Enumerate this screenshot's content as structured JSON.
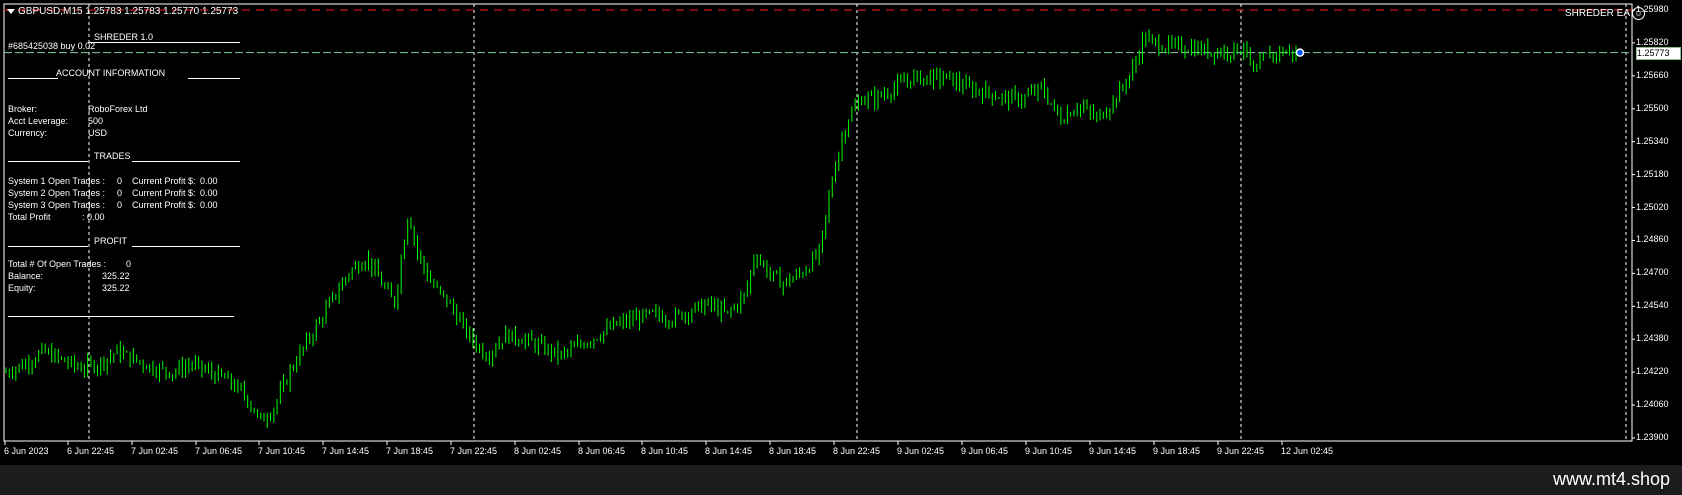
{
  "header": {
    "symbol_info": "GBPUSD,M15  1.25783 1.25783 1.25770 1.25773"
  },
  "ea_name": "SHREDER EA",
  "panel": {
    "title": "SHREDER 1.0",
    "account_heading": "ACCOUNT INFORMATION",
    "broker_label": "Broker:",
    "broker_value": "RoboForex Ltd",
    "leverage_label": "Acct Leverage:",
    "leverage_value": "500",
    "currency_label": "Currency:",
    "currency_value": "USD",
    "trades_heading": "TRADES",
    "systems": [
      {
        "label": "System 1 Open Trades :",
        "open": "0",
        "profit_label": "Current Profit $:",
        "profit": "0.00"
      },
      {
        "label": "System 2 Open Trades :",
        "open": "0",
        "profit_label": "Current Profit $:",
        "profit": "0.00"
      },
      {
        "label": "System 3 Open Trades :",
        "open": "0",
        "profit_label": "Current Profit $:",
        "profit": "0.00"
      }
    ],
    "total_profit_label": "Total Profit",
    "total_profit_value": ": 0.00",
    "profit_heading": "PROFIT",
    "open_trades_label": "Total # Of Open Trades :",
    "open_trades_value": "0",
    "balance_label": "Balance:",
    "balance_value": "325.22",
    "equity_label": "Equity:",
    "equity_value": "325.22"
  },
  "order_label": "#685425038 buy 0.02",
  "price_axis": {
    "labels": [
      "1.25980",
      "1.25820",
      "1.25773",
      "1.25660",
      "1.25500",
      "1.25340",
      "1.25180",
      "1.25020",
      "1.24860",
      "1.24700",
      "1.24540",
      "1.24380",
      "1.24220",
      "1.24060",
      "1.23900"
    ],
    "current": "1.25773"
  },
  "time_axis": {
    "labels": [
      "6 Jun 2023",
      "6 Jun 22:45",
      "7 Jun 02:45",
      "7 Jun 06:45",
      "7 Jun 10:45",
      "7 Jun 14:45",
      "7 Jun 18:45",
      "7 Jun 22:45",
      "8 Jun 02:45",
      "8 Jun 06:45",
      "8 Jun 10:45",
      "8 Jun 14:45",
      "8 Jun 18:45",
      "8 Jun 22:45",
      "9 Jun 02:45",
      "9 Jun 06:45",
      "9 Jun 10:45",
      "9 Jun 14:45",
      "9 Jun 18:45",
      "9 Jun 22:45",
      "12 Jun 02:45"
    ]
  },
  "chart_data": {
    "type": "candlestick",
    "symbol": "GBPUSD",
    "timeframe": "M15",
    "ylim": [
      1.239,
      1.2598
    ],
    "order_price": 1.25773,
    "stop_level": 1.2598,
    "close_path": [
      [
        0,
        1.2422
      ],
      [
        4,
        1.2426
      ],
      [
        8,
        1.2432
      ],
      [
        12,
        1.2428
      ],
      [
        16,
        1.2424
      ],
      [
        20,
        1.2426
      ],
      [
        24,
        1.2432
      ],
      [
        28,
        1.2428
      ],
      [
        32,
        1.2424
      ],
      [
        36,
        1.2422
      ],
      [
        40,
        1.2426
      ],
      [
        44,
        1.2422
      ],
      [
        48,
        1.2418
      ],
      [
        52,
        1.241
      ],
      [
        55,
        1.2398
      ],
      [
        58,
        1.2405
      ],
      [
        62,
        1.2425
      ],
      [
        66,
        1.244
      ],
      [
        70,
        1.2455
      ],
      [
        74,
        1.247
      ],
      [
        78,
        1.2478
      ],
      [
        80,
        1.247
      ],
      [
        84,
        1.2455
      ],
      [
        87,
        1.25
      ],
      [
        89,
        1.248
      ],
      [
        92,
        1.2465
      ],
      [
        96,
        1.2455
      ],
      [
        100,
        1.244
      ],
      [
        104,
        1.243
      ],
      [
        108,
        1.244
      ],
      [
        112,
        1.2438
      ],
      [
        116,
        1.2434
      ],
      [
        120,
        1.243
      ],
      [
        124,
        1.2435
      ],
      [
        128,
        1.244
      ],
      [
        132,
        1.2445
      ],
      [
        136,
        1.2448
      ],
      [
        140,
        1.245
      ],
      [
        144,
        1.2448
      ],
      [
        148,
        1.2452
      ],
      [
        152,
        1.2455
      ],
      [
        156,
        1.245
      ],
      [
        160,
        1.246
      ],
      [
        162,
        1.248
      ],
      [
        165,
        1.247
      ],
      [
        168,
        1.2465
      ],
      [
        172,
        1.247
      ],
      [
        176,
        1.248
      ],
      [
        179,
        1.252
      ],
      [
        182,
        1.2545
      ],
      [
        185,
        1.2555
      ],
      [
        188,
        1.2555
      ],
      [
        192,
        1.256
      ],
      [
        196,
        1.2565
      ],
      [
        200,
        1.2565
      ],
      [
        204,
        1.2565
      ],
      [
        208,
        1.256
      ],
      [
        212,
        1.2558
      ],
      [
        216,
        1.2555
      ],
      [
        220,
        1.2555
      ],
      [
        224,
        1.256
      ],
      [
        228,
        1.2545
      ],
      [
        232,
        1.2552
      ],
      [
        236,
        1.2545
      ],
      [
        240,
        1.2555
      ],
      [
        244,
        1.257
      ],
      [
        246,
        1.2585
      ],
      [
        248,
        1.2582
      ],
      [
        252,
        1.258
      ],
      [
        256,
        1.258
      ],
      [
        260,
        1.2578
      ],
      [
        264,
        1.2578
      ],
      [
        268,
        1.258
      ],
      [
        270,
        1.2565
      ],
      [
        272,
        1.2575
      ],
      [
        276,
        1.2578
      ],
      [
        279,
        1.2577
      ]
    ],
    "total_bars": 396
  }
}
